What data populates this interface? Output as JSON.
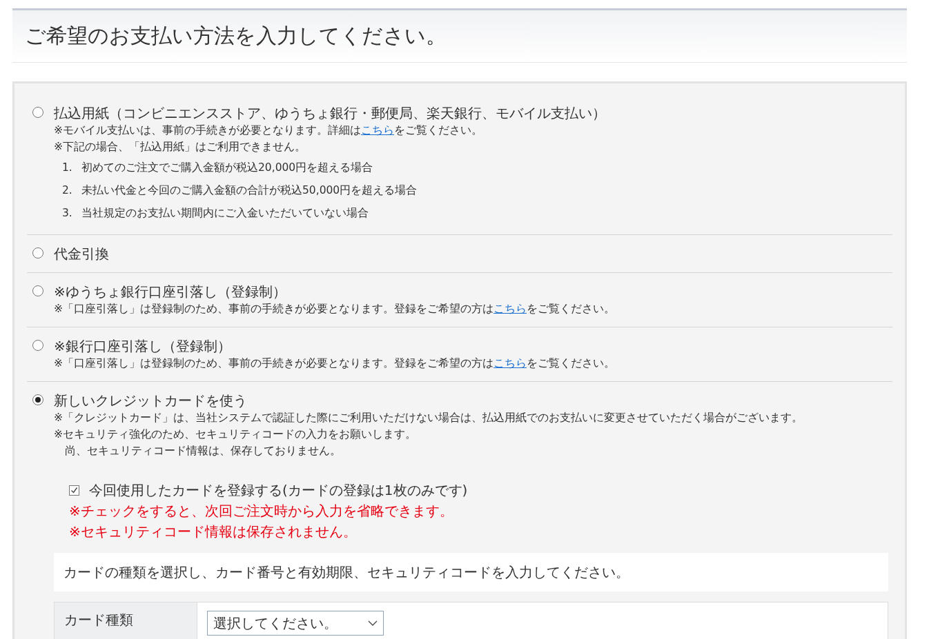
{
  "heading": "ご希望のお支払い方法を入力してください。",
  "options": [
    {
      "label": "払込用紙（コンビニエンスストア、ゆうちょ銀行・郵便局、楽天銀行、モバイル支払い）",
      "selected": false,
      "notes": [
        {
          "text": "※モバイル支払いは、事前の手続きが必要となります。詳細は",
          "link": "こちら",
          "text_after": "をご覧ください。",
          "indent": false
        },
        {
          "text": "※下記の場合、「払込用紙」はご利用できません。",
          "indent": false
        }
      ],
      "conditions": [
        {
          "number": "1.",
          "text": "初めてのご注文でご購入金額が税込20,000円を超える場合"
        },
        {
          "number": "2.",
          "text": "未払い代金と今回のご購入金額の合計が税込50,000円を超える場合"
        },
        {
          "number": "3.",
          "text": "当社規定のお支払い期間内にご入金いただいていない場合"
        }
      ]
    },
    {
      "label": "代金引換",
      "selected": false
    },
    {
      "label": "※ゆうちょ銀行口座引落し（登録制）",
      "selected": false,
      "notes": [
        {
          "text": "※「口座引落し」は登録制のため、事前の手続きが必要となります。登録をご希望の方は",
          "link": "こちら",
          "text_after": "をご覧ください。",
          "indent": false
        }
      ]
    },
    {
      "label": "※銀行口座引落し（登録制）",
      "selected": false,
      "notes": [
        {
          "text": "※「口座引落し」は登録制のため、事前の手続きが必要となります。登録をご希望の方は",
          "link": "こちら",
          "text_after": "をご覧ください。",
          "indent": false
        }
      ]
    },
    {
      "label": "新しいクレジットカードを使う",
      "selected": true,
      "notes": [
        {
          "text": "※「クレジットカード」は、当社システムで認証した際にご利用いただけない場合は、払込用紙でのお支払いに変更させていただく場合がございます。",
          "indent": false
        },
        {
          "text": "※セキュリティ強化のため、セキュリティコードの入力をお願いします。",
          "indent": false
        },
        {
          "text": "尚、セキュリティコード情報は、保存しておりません。",
          "indent": true
        }
      ],
      "card_form": {
        "save_card": {
          "label": "今回使用したカードを登録する(カードの登録は1枚のみです)",
          "checked": true
        },
        "warnings": [
          "※チェックをすると、次回ご注文時から入力を省略できます。",
          "※セキュリティコード情報は保存されません。"
        ],
        "instruction": "カードの種類を選択し、カード番号と有効期限、セキュリティコードを入力してください。",
        "fields": [
          {
            "label": "カード種類",
            "kind": "select",
            "value": "選択してください。"
          }
        ]
      }
    }
  ]
}
